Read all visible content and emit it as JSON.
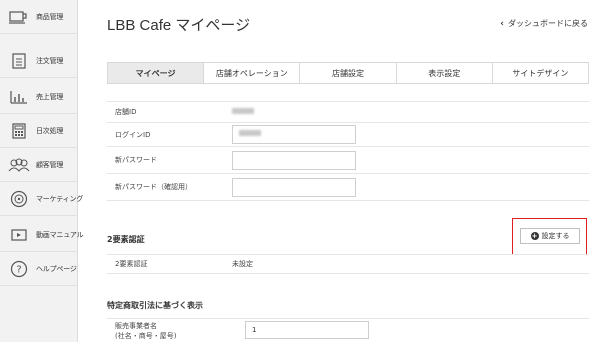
{
  "sidebar": {
    "items": [
      {
        "label": "商品管理",
        "icon": "cup-icon"
      },
      {
        "label": "注文管理",
        "icon": "document-icon"
      },
      {
        "label": "売上管理",
        "icon": "bar-chart-icon"
      },
      {
        "label": "日次処理",
        "icon": "calculator-icon"
      },
      {
        "label": "顧客管理",
        "icon": "users-icon"
      },
      {
        "label": "マーケティング",
        "icon": "target-icon"
      },
      {
        "label": "動画マニュアル",
        "icon": "video-icon"
      },
      {
        "label": "ヘルプページ",
        "icon": "help-icon"
      }
    ]
  },
  "header": {
    "title": "LBB Cafe マイページ",
    "back_label": "ダッシュボードに戻る"
  },
  "tabs": [
    {
      "label": "マイページ",
      "active": true
    },
    {
      "label": "店舗オペレーション",
      "active": false
    },
    {
      "label": "店舗設定",
      "active": false
    },
    {
      "label": "表示設定",
      "active": false
    },
    {
      "label": "サイトデザイン",
      "active": false
    }
  ],
  "account": {
    "store_id_label": "店舗ID",
    "login_id_label": "ログインID",
    "new_password_label": "新パスワード",
    "new_password_confirm_label": "新パスワード（確認用）"
  },
  "two_factor": {
    "section_title": "2要素認証",
    "button_label": "設定する",
    "row_label": "2要素認証",
    "row_value": "未設定"
  },
  "commerce_law": {
    "section_title": "特定商取引法に基づく表示",
    "business_name_label_1": "販売事業者名",
    "business_name_label_2": "(社名・商号・屋号)",
    "business_name_value": "1"
  },
  "colors": {
    "highlight": "#e02020",
    "active_tab": "#eaeaea",
    "sidebar_bg": "#f2f2f2"
  }
}
